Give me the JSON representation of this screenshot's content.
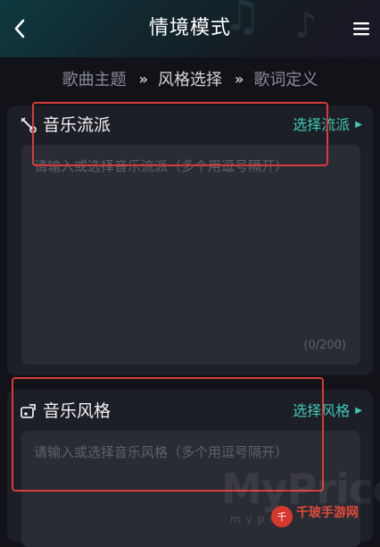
{
  "header": {
    "title": "情境模式",
    "back_icon": "chevron-left-icon",
    "menu_icon": "hamburger-menu-icon"
  },
  "steps": [
    {
      "label": "歌曲主题"
    },
    {
      "label": "风格选择"
    },
    {
      "label": "歌词定义"
    }
  ],
  "step_separator": "»",
  "genre_card": {
    "title": "音乐流派",
    "action": "选择流派",
    "placeholder": "请输入或选择音乐流派（多个用逗号隔开）",
    "counter": "(0/200)"
  },
  "style_card": {
    "title": "音乐风格",
    "action": "选择风格",
    "placeholder": "请输入或选择音乐风格（多个用逗号隔开）"
  },
  "watermark": {
    "brand": "MyPrice",
    "sub": "mypr",
    "logo": "千",
    "site": "千玻手游网"
  },
  "colors": {
    "accent": "#3ec9b8",
    "highlight": "#d83a3a",
    "background": "#121318",
    "card": "#1d1f26"
  }
}
